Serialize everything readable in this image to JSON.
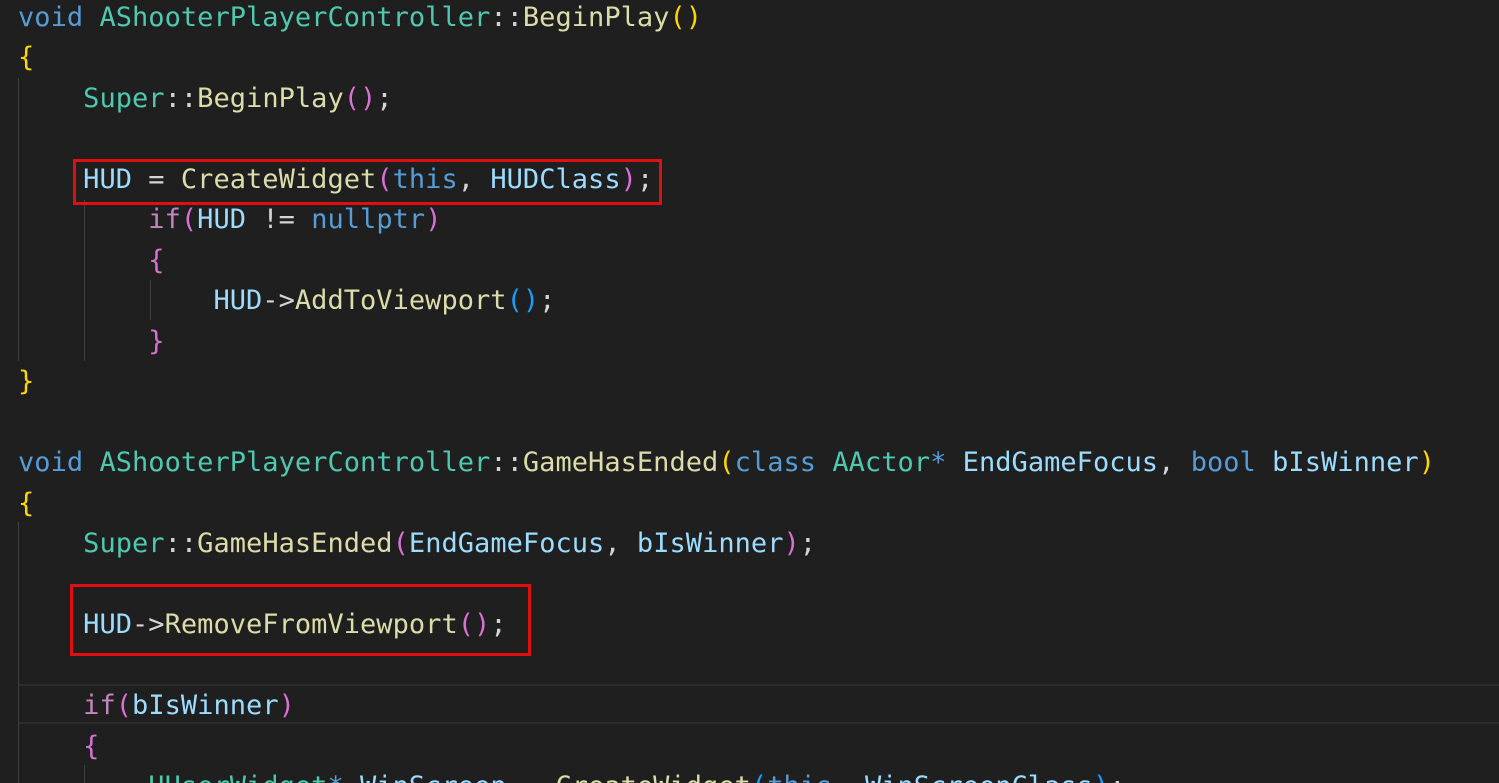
{
  "colors": {
    "background": "#1f1f1f",
    "keyword": "#569cd6",
    "type": "#4ec9b0",
    "function": "#dcdcaa",
    "variable": "#9cdcfe",
    "control": "#c586c0",
    "bracket_level_1": "#ffd700",
    "bracket_level_2": "#da70d6",
    "bracket_level_3": "#179fff",
    "punctuation": "#d4d4d4",
    "highlight_box": "#e01010"
  },
  "code_lines": [
    [
      {
        "t": "void",
        "c": "keyword"
      },
      {
        "t": " "
      },
      {
        "t": "AShooterPlayerController",
        "c": "type"
      },
      {
        "t": "::"
      },
      {
        "t": "BeginPlay",
        "c": "function"
      },
      {
        "t": "()",
        "c": "bracket_level_1"
      }
    ],
    [
      {
        "t": "{",
        "c": "bracket_level_1"
      }
    ],
    [
      {
        "t": "    "
      },
      {
        "t": "Super",
        "c": "type"
      },
      {
        "t": "::"
      },
      {
        "t": "BeginPlay",
        "c": "function"
      },
      {
        "t": "()",
        "c": "bracket_level_2"
      },
      {
        "t": ";"
      }
    ],
    [],
    [
      {
        "t": "    "
      },
      {
        "t": "HUD",
        "c": "variable"
      },
      {
        "t": " = "
      },
      {
        "t": "CreateWidget",
        "c": "function"
      },
      {
        "t": "(",
        "c": "bracket_level_2"
      },
      {
        "t": "this",
        "c": "keyword"
      },
      {
        "t": ", "
      },
      {
        "t": "HUDClass",
        "c": "variable"
      },
      {
        "t": ")",
        "c": "bracket_level_2"
      },
      {
        "t": ";"
      }
    ],
    [
      {
        "t": "        "
      },
      {
        "t": "if",
        "c": "control"
      },
      {
        "t": "(",
        "c": "bracket_level_2"
      },
      {
        "t": "HUD",
        "c": "variable"
      },
      {
        "t": " != "
      },
      {
        "t": "nullptr",
        "c": "keyword"
      },
      {
        "t": ")",
        "c": "bracket_level_2"
      }
    ],
    [
      {
        "t": "        "
      },
      {
        "t": "{",
        "c": "bracket_level_2"
      }
    ],
    [
      {
        "t": "            "
      },
      {
        "t": "HUD",
        "c": "variable"
      },
      {
        "t": "->"
      },
      {
        "t": "AddToViewport",
        "c": "function"
      },
      {
        "t": "()",
        "c": "bracket_level_3"
      },
      {
        "t": ";"
      }
    ],
    [
      {
        "t": "        "
      },
      {
        "t": "}",
        "c": "bracket_level_2"
      }
    ],
    [
      {
        "t": "}",
        "c": "bracket_level_1"
      }
    ],
    [],
    [
      {
        "t": "void",
        "c": "keyword"
      },
      {
        "t": " "
      },
      {
        "t": "AShooterPlayerController",
        "c": "type"
      },
      {
        "t": "::"
      },
      {
        "t": "GameHasEnded",
        "c": "function"
      },
      {
        "t": "(",
        "c": "bracket_level_1"
      },
      {
        "t": "class",
        "c": "keyword"
      },
      {
        "t": " "
      },
      {
        "t": "AActor",
        "c": "type"
      },
      {
        "t": "*",
        "c": "keyword"
      },
      {
        "t": " "
      },
      {
        "t": "EndGameFocus",
        "c": "variable"
      },
      {
        "t": ", "
      },
      {
        "t": "bool",
        "c": "keyword"
      },
      {
        "t": " "
      },
      {
        "t": "bIsWinner",
        "c": "variable"
      },
      {
        "t": ")",
        "c": "bracket_level_1"
      }
    ],
    [
      {
        "t": "{",
        "c": "bracket_level_1"
      }
    ],
    [
      {
        "t": "    "
      },
      {
        "t": "Super",
        "c": "type"
      },
      {
        "t": "::"
      },
      {
        "t": "GameHasEnded",
        "c": "function"
      },
      {
        "t": "(",
        "c": "bracket_level_2"
      },
      {
        "t": "EndGameFocus",
        "c": "variable"
      },
      {
        "t": ", "
      },
      {
        "t": "bIsWinner",
        "c": "variable"
      },
      {
        "t": ")",
        "c": "bracket_level_2"
      },
      {
        "t": ";"
      }
    ],
    [],
    [
      {
        "t": "    "
      },
      {
        "t": "HUD",
        "c": "variable"
      },
      {
        "t": "->"
      },
      {
        "t": "RemoveFromViewport",
        "c": "function"
      },
      {
        "t": "()",
        "c": "bracket_level_2"
      },
      {
        "t": ";"
      }
    ],
    [],
    [
      {
        "t": "    "
      },
      {
        "t": "if",
        "c": "control"
      },
      {
        "t": "(",
        "c": "bracket_level_2"
      },
      {
        "t": "bIsWinner",
        "c": "variable"
      },
      {
        "t": ")",
        "c": "bracket_level_2"
      }
    ],
    [
      {
        "t": "    "
      },
      {
        "t": "{",
        "c": "bracket_level_2"
      }
    ],
    [
      {
        "t": "        "
      },
      {
        "t": "UUserWidget",
        "c": "type"
      },
      {
        "t": "*",
        "c": "keyword"
      },
      {
        "t": " "
      },
      {
        "t": "WinScreen",
        "c": "variable"
      },
      {
        "t": " = "
      },
      {
        "t": "CreateWidget",
        "c": "function"
      },
      {
        "t": "(",
        "c": "bracket_level_3"
      },
      {
        "t": "this",
        "c": "keyword"
      },
      {
        "t": ", "
      },
      {
        "t": "WinScreenClass",
        "c": "variable"
      },
      {
        "t": ")",
        "c": "bracket_level_3"
      },
      {
        "t": ";"
      }
    ]
  ]
}
